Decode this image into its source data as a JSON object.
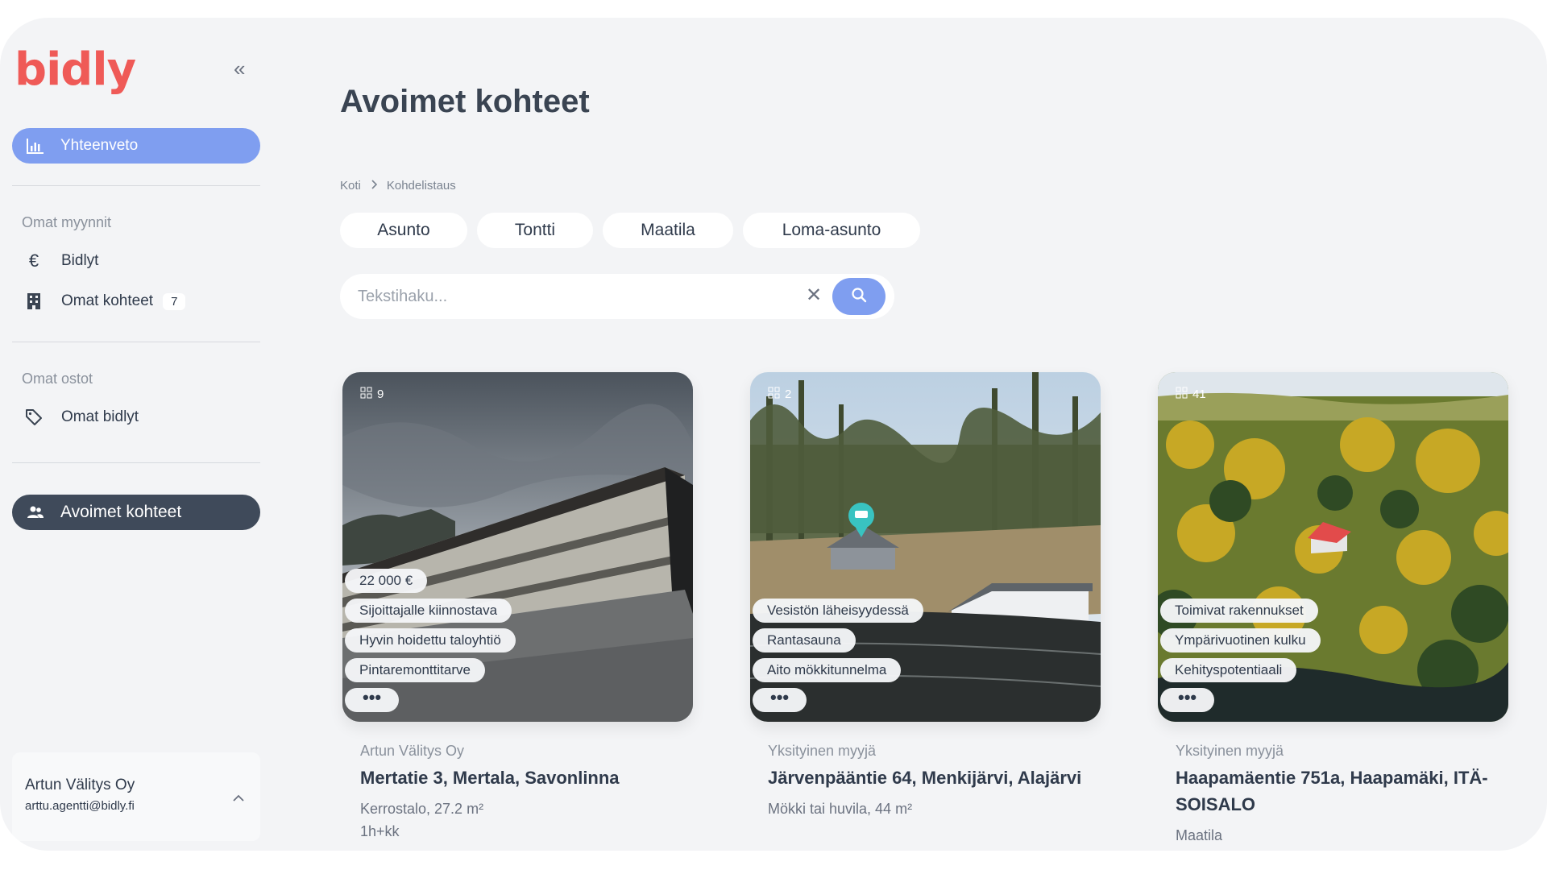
{
  "brand": {
    "logo_text": "bidly",
    "accent": "#ef5a57"
  },
  "sidebar": {
    "collapse_icon": "double-chevron-left-icon",
    "summary": {
      "label": "Yhteenveto",
      "icon": "bar-chart-icon"
    },
    "sections": [
      {
        "label": "Omat myynnit",
        "items": [
          {
            "label": "Bidlyt",
            "icon": "euro-icon"
          },
          {
            "label": "Omat kohteet",
            "icon": "building-icon",
            "count": "7"
          }
        ]
      },
      {
        "label": "Omat ostot",
        "items": [
          {
            "label": "Omat bidlyt",
            "icon": "tag-icon"
          }
        ]
      }
    ],
    "active": {
      "label": "Avoimet kohteet",
      "icon": "users-icon"
    },
    "user": {
      "name": "Artun Välitys Oy",
      "email": "arttu.agentti@bidly.fi"
    }
  },
  "main": {
    "title": "Avoimet kohteet",
    "breadcrumb": [
      "Koti",
      "Kohdelistaus"
    ],
    "tabs": [
      "Asunto",
      "Tontti",
      "Maatila",
      "Loma-asunto"
    ],
    "search": {
      "placeholder": "Tekstihaku..."
    },
    "listings": [
      {
        "photo_count": "9",
        "price": "22 000 €",
        "tags": [
          "Sijoittajalle kiinnostava",
          "Hyvin hoidettu taloyhtiö",
          "Pintaremonttitarve"
        ],
        "more": "•••",
        "seller": "Artun Välitys Oy",
        "address": "Mertatie 3, Mertala, Savonlinna",
        "type": "Kerrostalo, 27.2 m²",
        "rooms": "1h+kk"
      },
      {
        "photo_count": "2",
        "tags": [
          "Vesistön läheisyydessä",
          "Rantasauna",
          "Aito mökkitunnelma"
        ],
        "more": "•••",
        "seller": "Yksityinen myyjä",
        "address": "Järvenpääntie 64, Menkijärvi, Alajärvi",
        "type": "Mökki tai huvila, 44 m²"
      },
      {
        "photo_count": "41",
        "tags": [
          "Toimivat rakennukset",
          "Ympärivuotinen kulku",
          "Kehityspotentiaali"
        ],
        "more": "•••",
        "seller": "Yksityinen myyjä",
        "address": "Haapamäentie 751a, Haapamäki, ITÄ-SOISALO",
        "type": "Maatila"
      }
    ]
  }
}
